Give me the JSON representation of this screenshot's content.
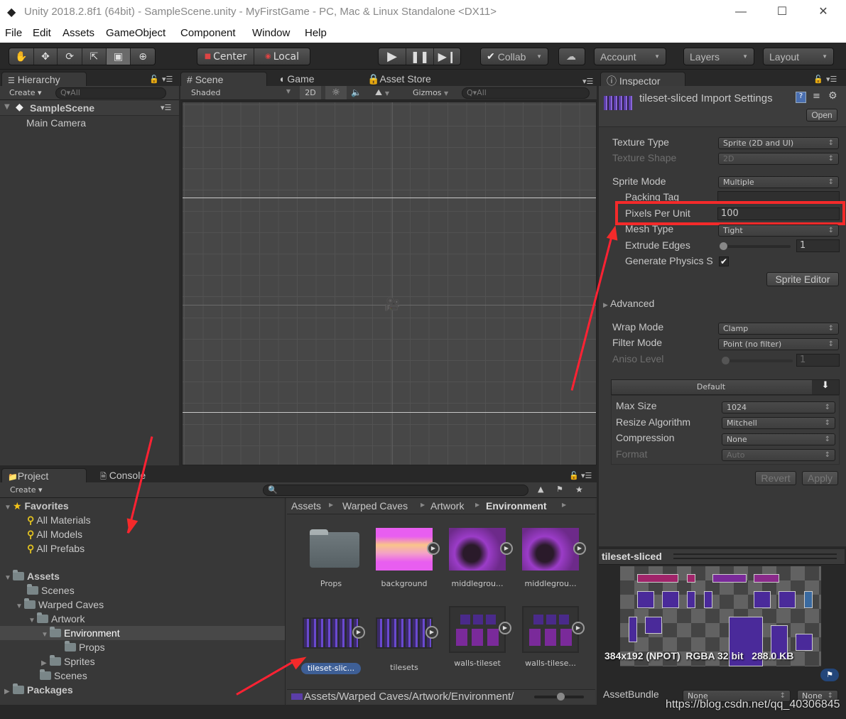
{
  "window": {
    "title": "Unity 2018.2.8f1 (64bit) - SampleScene.unity - MyFirstGame - PC, Mac & Linux Standalone <DX11>",
    "controls": {
      "minimize": "—",
      "maximize": "☐",
      "close": "✕"
    }
  },
  "menu": [
    "File",
    "Edit",
    "Assets",
    "GameObject",
    "Component",
    "Window",
    "Help"
  ],
  "toolbar": {
    "tools": [
      "hand-icon",
      "move-icon",
      "rotate-icon",
      "scale-icon",
      "rect-tool-icon",
      "transform-icon"
    ],
    "active_tool": "rect-tool-icon",
    "pivot": "Center",
    "space": "Local",
    "collab": "Collab",
    "account": "Account",
    "layers": "Layers",
    "layout": "Layout"
  },
  "hierarchy": {
    "tab": "Hierarchy",
    "create": "Create",
    "search_placeholder": "Q▾All",
    "scene": "SampleScene",
    "items": [
      "Main Camera"
    ]
  },
  "scene_view": {
    "tabs": [
      "Scene",
      "Game",
      "Asset Store"
    ],
    "active_tab": "Scene",
    "shading": "Shaded",
    "mode_2d": "2D",
    "gizmos": "Gizmos",
    "search_placeholder": "Q▾All"
  },
  "inspector": {
    "tab": "Inspector",
    "header_title": "tileset-sliced Import Settings",
    "open_button": "Open",
    "fields": {
      "texture_type": {
        "label": "Texture Type",
        "value": "Sprite (2D and UI)"
      },
      "texture_shape": {
        "label": "Texture Shape",
        "value": "2D"
      },
      "sprite_mode": {
        "label": "Sprite Mode",
        "value": "Multiple"
      },
      "packing_tag": {
        "label": "Packing Tag",
        "value": ""
      },
      "pixels_per_unit": {
        "label": "Pixels Per Unit",
        "value": "100"
      },
      "mesh_type": {
        "label": "Mesh Type",
        "value": "Tight"
      },
      "extrude_edges": {
        "label": "Extrude Edges",
        "value": "1"
      },
      "generate_physics": {
        "label": "Generate Physics S",
        "checked": true
      }
    },
    "sprite_editor_button": "Sprite Editor",
    "advanced": "Advanced",
    "wrap_mode": {
      "label": "Wrap Mode",
      "value": "Clamp"
    },
    "filter_mode": {
      "label": "Filter Mode",
      "value": "Point (no filter)"
    },
    "aniso_level": {
      "label": "Aniso Level",
      "value": "1"
    },
    "platform_tab": "Default",
    "max_size": {
      "label": "Max Size",
      "value": "1024"
    },
    "resize_algorithm": {
      "label": "Resize Algorithm",
      "value": "Mitchell"
    },
    "compression": {
      "label": "Compression",
      "value": "None"
    },
    "format": {
      "label": "Format",
      "value": "Auto"
    },
    "revert": "Revert",
    "apply": "Apply",
    "preview_title": "tileset-sliced",
    "preview_info": "384x192 (NPOT)  RGBA 32 bit   288.0 KB",
    "asset_bundle": {
      "label": "AssetBundle",
      "name": "None",
      "variant": "None"
    }
  },
  "project": {
    "tabs": [
      "Project",
      "Console"
    ],
    "create": "Create",
    "favorites": {
      "label": "Favorites",
      "items": [
        "All Materials",
        "All Models",
        "All Prefabs"
      ]
    },
    "tree": [
      {
        "label": "Assets",
        "depth": 0,
        "bold": true,
        "expanded": true
      },
      {
        "label": "Scenes",
        "depth": 1
      },
      {
        "label": "Warped Caves",
        "depth": 1,
        "expanded": true
      },
      {
        "label": "Artwork",
        "depth": 2,
        "expanded": true
      },
      {
        "label": "Environment",
        "depth": 3,
        "expanded": true,
        "selected": true
      },
      {
        "label": "Props",
        "depth": 4
      },
      {
        "label": "Sprites",
        "depth": 3,
        "collapsed": true
      },
      {
        "label": "Scenes",
        "depth": 2
      },
      {
        "label": "Packages",
        "depth": 0,
        "bold": true,
        "collapsed": true
      }
    ],
    "breadcrumb": [
      "Assets",
      "Warped Caves",
      "Artwork",
      "Environment"
    ],
    "assets": [
      {
        "name": "Props",
        "type": "folder"
      },
      {
        "name": "background",
        "type": "texture"
      },
      {
        "name": "middlegrou...",
        "type": "texture"
      },
      {
        "name": "middlegrou...",
        "type": "texture"
      },
      {
        "name": "tileset-slic...",
        "type": "texture",
        "selected": true
      },
      {
        "name": "tilesets",
        "type": "texture"
      },
      {
        "name": "walls-tileset",
        "type": "texture"
      },
      {
        "name": "walls-tilese...",
        "type": "texture"
      }
    ],
    "path": "Assets/Warped Caves/Artwork/Environment/"
  },
  "watermark": "https://blog.csdn.net/qq_40306845",
  "colors": {
    "annotation_red": "#f42a2a",
    "selection_blue": "#3e5f96"
  }
}
